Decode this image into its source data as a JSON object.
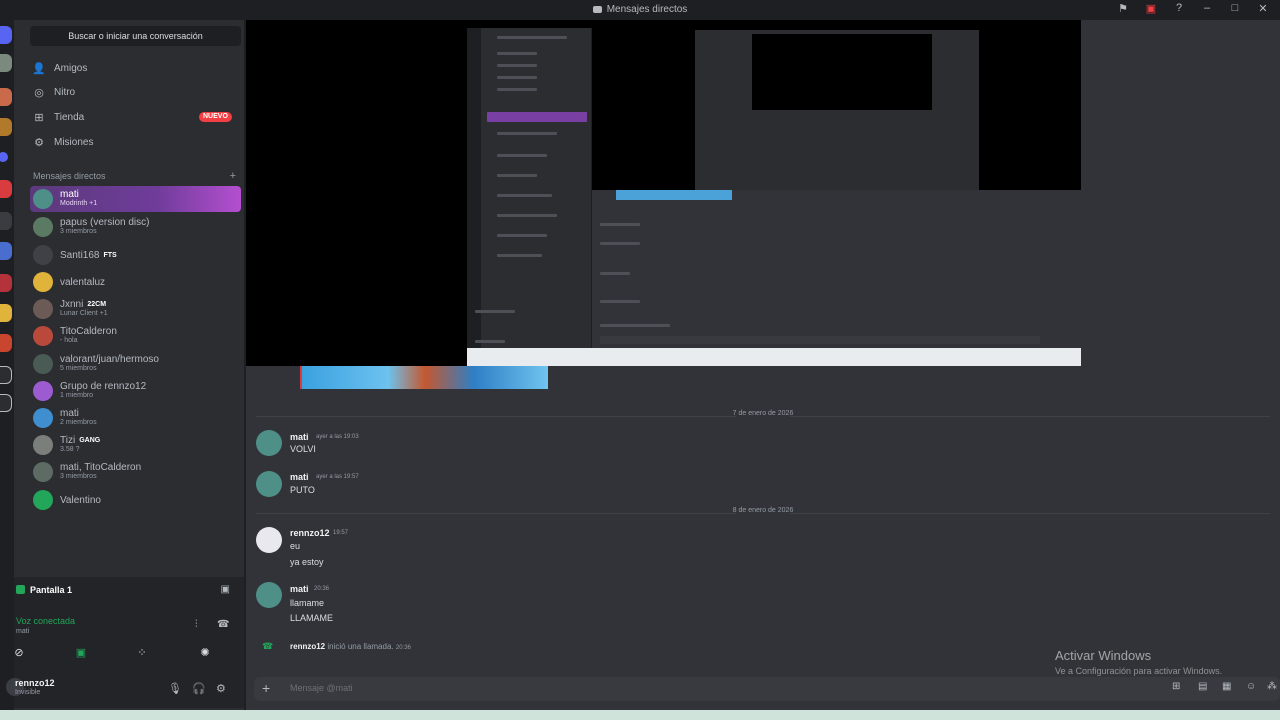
{
  "window": {
    "title": "Mensajes directos",
    "icons": [
      "flag-icon",
      "screen-share-icon",
      "help-icon",
      "minimize-icon",
      "maximize-icon",
      "close-icon"
    ]
  },
  "sidebar": {
    "search_placeholder": "Buscar o iniciar una conversación",
    "nav": [
      {
        "label": "Amigos",
        "icon": "friends-icon"
      },
      {
        "label": "Nitro",
        "icon": "nitro-icon"
      },
      {
        "label": "Tienda",
        "icon": "store-icon",
        "badge": "NUEVO"
      },
      {
        "label": "Misiones",
        "icon": "quests-icon"
      }
    ],
    "dm_header": "Mensajes directos",
    "dms": [
      {
        "name": "mati",
        "sub": "Modrinth +1",
        "active": true,
        "color": "#4e8f87"
      },
      {
        "name": "papus (version disc)",
        "sub": "3 miembros",
        "color": "#5b7a63"
      },
      {
        "name": "Santi168",
        "tag": "FTS",
        "sub": "",
        "color": "#3f4147"
      },
      {
        "name": "valentaluz",
        "sub": "",
        "color": "#e0b33a"
      },
      {
        "name": "Jxnni",
        "tag": "22CM",
        "sub": "Lunar Client +1",
        "color": "#6b5a55"
      },
      {
        "name": "TitoCalderon",
        "sub": "- hola",
        "color": "#b8493b"
      },
      {
        "name": "valorant/juan/hermoso",
        "sub": "5 miembros",
        "color": "#4a5a55"
      },
      {
        "name": "Grupo de rennzo12",
        "sub": "1 miembro",
        "color": "#9d5bd2"
      },
      {
        "name": "mati",
        "sub": "2 miembros",
        "color": "#3e8ed0"
      },
      {
        "name": "Tizi",
        "tag": "GANG",
        "sub": "3.58 ?",
        "color": "#7a7f7c"
      },
      {
        "name": "mati, TitoCalderon",
        "sub": "3 miembros",
        "color": "#5e6a64"
      },
      {
        "name": "Valentino",
        "sub": "",
        "color": "#23a55a"
      }
    ]
  },
  "voice": {
    "stream_title": "Pantalla 1",
    "status": "Voz conectada",
    "channel": "mati"
  },
  "user": {
    "name": "rennzo12",
    "status": "Invisible"
  },
  "chat": {
    "date1": "7 de enero de 2026",
    "date2": "8 de enero de 2026",
    "messages": [
      {
        "author": "mati",
        "time": "ayer a las 19:03",
        "lines": [
          "VOLVI"
        ]
      },
      {
        "author": "mati",
        "time": "ayer a las 19:57",
        "lines": [
          "PUTO"
        ]
      },
      {
        "author": "rennzo12",
        "time": "19:57",
        "lines": [
          "eu",
          "ya estoy"
        ]
      },
      {
        "author": "mati",
        "time": "20:36",
        "lines": [
          "llamame",
          "LLAMAME"
        ]
      }
    ],
    "call": {
      "author": "rennzo12",
      "text": "inició una llamada.",
      "time": "20:36"
    },
    "composer_placeholder": "Mensaje @mati"
  },
  "watermark": {
    "title": "Activar Windows",
    "subtitle": "Ve a Configuración para activar Windows."
  }
}
